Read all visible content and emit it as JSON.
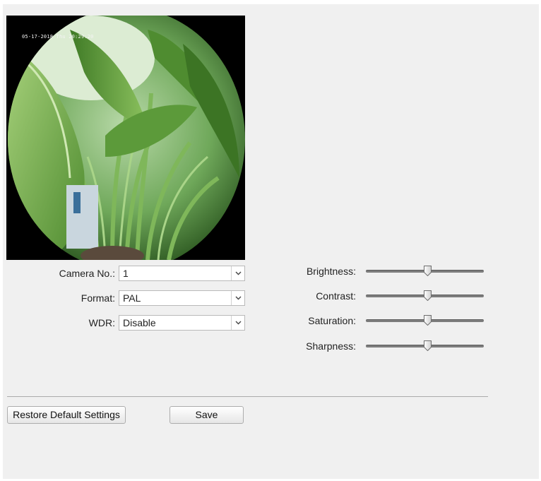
{
  "preview": {
    "osd_text": "05-17-2018 Thu 20:29:20"
  },
  "form": {
    "camera_no": {
      "label": "Camera No.:",
      "value": "1"
    },
    "format": {
      "label": "Format:",
      "value": "PAL"
    },
    "wdr": {
      "label": "WDR:",
      "value": "Disable"
    }
  },
  "sliders": [
    {
      "label": "Brightness:",
      "value": 50
    },
    {
      "label": "Contrast:",
      "value": 50
    },
    {
      "label": "Saturation:",
      "value": 50
    },
    {
      "label": "Sharpness:",
      "value": 50
    }
  ],
  "buttons": {
    "restore": "Restore Default Settings",
    "save": "Save"
  },
  "icons": {
    "dropdown": "chevron-down-icon",
    "slider_thumb": "slider-thumb-icon"
  },
  "colors": {
    "panel_bg": "#f0f0f0",
    "track": "#7d7d7d"
  }
}
